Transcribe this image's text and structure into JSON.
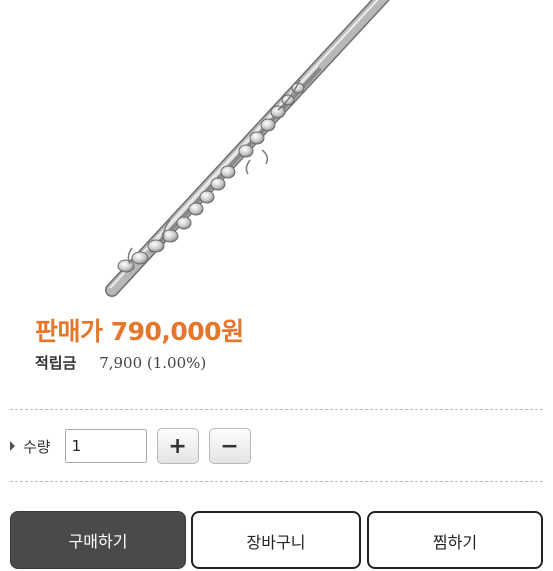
{
  "product": {
    "price_text": "판매가 790,000원",
    "points_label": "적립금",
    "points_value": "7,900 (1.00%)"
  },
  "quantity": {
    "label": "수량",
    "value": "1",
    "plus_label": "+",
    "minus_label": "−"
  },
  "actions": {
    "buy_label": "구매하기",
    "cart_label": "장바구니",
    "wish_label": "찜하기"
  },
  "colors": {
    "price": "#e5762a",
    "buy_button": "#4a4a4a"
  }
}
